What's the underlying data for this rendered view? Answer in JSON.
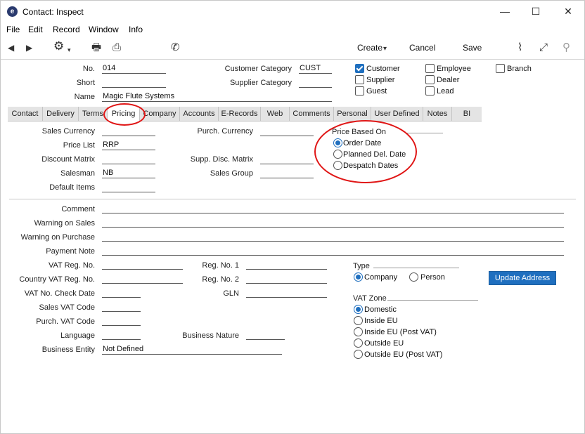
{
  "window": {
    "title": "Contact: Inspect",
    "app_icon_glyph": "e",
    "minimize_glyph": "—",
    "maximize_glyph": "☐",
    "close_glyph": "✕"
  },
  "menu": [
    "File",
    "Edit",
    "Record",
    "Window",
    "Info"
  ],
  "toolbar": {
    "create_label": "Create",
    "cancel_label": "Cancel",
    "save_label": "Save",
    "icons": {
      "back": "◀",
      "forward": "▶",
      "settings": "⚙",
      "print": "🖶",
      "print_preview": "⎙",
      "phone": "✆",
      "create_dropdown": "▾",
      "activity": "⌇",
      "expand": "⤢",
      "attach": "⚲"
    }
  },
  "header": {
    "no_label": "No.",
    "no_value": "014",
    "short_label": "Short",
    "short_value": "",
    "name_label": "Name",
    "name_value": "Magic Flute Systems",
    "customer_category_label": "Customer Category",
    "customer_category_value": "CUST",
    "supplier_category_label": "Supplier Category",
    "supplier_category_value": ""
  },
  "checkboxes": [
    {
      "label": "Customer",
      "checked": true
    },
    {
      "label": "Supplier",
      "checked": false
    },
    {
      "label": "Guest",
      "checked": false
    },
    {
      "label": "Employee",
      "checked": false
    },
    {
      "label": "Dealer",
      "checked": false
    },
    {
      "label": "Lead",
      "checked": false
    },
    {
      "label": "Branch",
      "checked": false
    }
  ],
  "tabs": [
    "Contact",
    "Delivery",
    "Terms",
    "Pricing",
    "Company",
    "Accounts",
    "E-Records",
    "Web",
    "Comments",
    "Personal",
    "User Defined",
    "Notes",
    "BI"
  ],
  "active_tab": "Pricing",
  "pricing": {
    "sales_currency_label": "Sales Currency",
    "sales_currency_value": "",
    "price_list_label": "Price List",
    "price_list_value": "RRP",
    "discount_matrix_label": "Discount Matrix",
    "discount_matrix_value": "",
    "salesman_label": "Salesman",
    "salesman_value": "NB",
    "default_items_label": "Default Items",
    "default_items_value": "",
    "purch_currency_label": "Purch. Currency",
    "purch_currency_value": "",
    "supp_disc_matrix_label": "Supp. Disc. Matrix",
    "supp_disc_matrix_value": "",
    "sales_group_label": "Sales Group",
    "sales_group_value": "",
    "price_based_on_label": "Price Based On",
    "price_based_on_options": [
      {
        "label": "Order Date",
        "checked": true
      },
      {
        "label": "Planned Del. Date",
        "checked": false
      },
      {
        "label": "Despatch Dates",
        "checked": false
      }
    ]
  },
  "notes": {
    "comment_label": "Comment",
    "warning_sales_label": "Warning on Sales",
    "warning_purchase_label": "Warning on Purchase",
    "payment_note_label": "Payment Note"
  },
  "lower": {
    "vat_reg_label": "VAT Reg. No.",
    "country_vat_label": "Country VAT Reg. No.",
    "vat_check_date_label": "VAT No. Check Date",
    "sales_vat_code_label": "Sales VAT Code",
    "purch_vat_code_label": "Purch. VAT Code",
    "language_label": "Language",
    "business_entity_label": "Business Entity",
    "business_entity_value": "Not Defined",
    "reg_no1_label": "Reg. No. 1",
    "reg_no2_label": "Reg. No. 2",
    "gln_label": "GLN",
    "business_nature_label": "Business Nature",
    "type_label": "Type",
    "type_options": [
      {
        "label": "Company",
        "checked": true
      },
      {
        "label": "Person",
        "checked": false
      }
    ],
    "update_address_label": "Update Address",
    "vat_zone_label": "VAT Zone",
    "vat_zone_options": [
      {
        "label": "Domestic",
        "checked": true
      },
      {
        "label": "Inside EU",
        "checked": false
      },
      {
        "label": "Inside EU (Post VAT)",
        "checked": false
      },
      {
        "label": "Outside EU",
        "checked": false
      },
      {
        "label": "Outside EU (Post VAT)",
        "checked": false
      }
    ]
  },
  "colors": {
    "accent": "#1f6fbf",
    "highlight": "#e01616"
  }
}
